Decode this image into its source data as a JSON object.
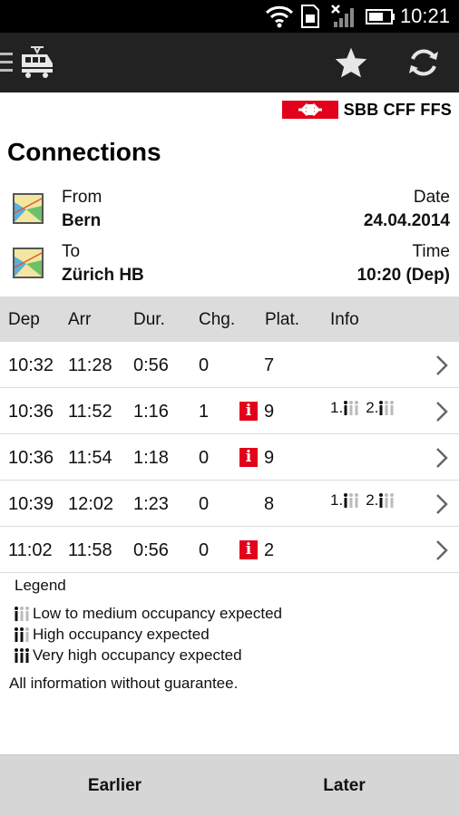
{
  "status_bar": {
    "time": "10:21"
  },
  "action_bar": {
    "app_icon": "train-icon",
    "favorite_icon": "star-icon",
    "refresh_icon": "refresh-icon"
  },
  "brand": {
    "logo_text": "SBB CFF FFS",
    "color": "#e2001a"
  },
  "page_title": "Connections",
  "route": {
    "from_label": "From",
    "from_value": "Bern",
    "to_label": "To",
    "to_value": "Zürich HB",
    "date_label": "Date",
    "date_value": "24.04.2014",
    "time_label": "Time",
    "time_value": "10:20 (Dep)"
  },
  "table": {
    "headers": {
      "dep": "Dep",
      "arr": "Arr",
      "dur": "Dur.",
      "chg": "Chg.",
      "plat": "Plat.",
      "info": "Info"
    },
    "rows": [
      {
        "dep": "10:32",
        "arr": "11:28",
        "dur": "0:56",
        "chg": "0",
        "plat": "7",
        "has_info": false,
        "occ1": "",
        "occ2": ""
      },
      {
        "dep": "10:36",
        "arr": "11:52",
        "dur": "1:16",
        "chg": "1",
        "plat": "9",
        "has_info": true,
        "info_glyph": "i",
        "occ1": "1.",
        "occ2": "2."
      },
      {
        "dep": "10:36",
        "arr": "11:54",
        "dur": "1:18",
        "chg": "0",
        "plat": "9",
        "has_info": true,
        "info_glyph": "i",
        "occ1": "",
        "occ2": ""
      },
      {
        "dep": "10:39",
        "arr": "12:02",
        "dur": "1:23",
        "chg": "0",
        "plat": "8",
        "has_info": false,
        "occ1": "1.",
        "occ2": "2."
      },
      {
        "dep": "11:02",
        "arr": "11:58",
        "dur": "0:56",
        "chg": "0",
        "plat": "2",
        "has_info": true,
        "info_glyph": "i",
        "occ1": "",
        "occ2": ""
      }
    ]
  },
  "legend": {
    "title": "Legend",
    "low": "Low to medium occupancy expected",
    "high": "High occupancy expected",
    "very_high": "Very high occupancy expected",
    "disclaimer": "All information without guarantee."
  },
  "buttons": {
    "earlier": "Earlier",
    "later": "Later"
  }
}
